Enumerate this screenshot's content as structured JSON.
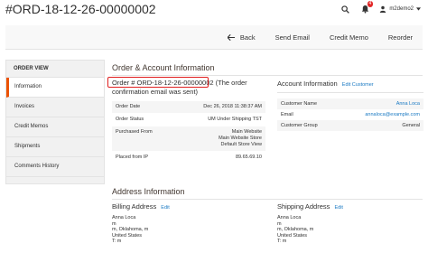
{
  "page": {
    "title": "#ORD-18-12-26-00000002"
  },
  "topbar": {
    "notification_count": "4",
    "username": "m2demo2"
  },
  "actions": {
    "back_label": "Back",
    "send_email_label": "Send Email",
    "credit_memo_label": "Credit Memo",
    "reorder_label": "Reorder"
  },
  "sidebar": {
    "heading": "ORDER VIEW",
    "items": [
      {
        "label": "Information"
      },
      {
        "label": "Invoices"
      },
      {
        "label": "Credit Memos"
      },
      {
        "label": "Shipments"
      },
      {
        "label": "Comments History"
      }
    ]
  },
  "order_account": {
    "section_title": "Order & Account Information",
    "order_line1": "Order # ORD-18-12-26-00000002 (The order",
    "order_line2": "confirmation email was sent)",
    "rows": [
      {
        "label": "Order Date",
        "value": "Dec 26, 2018 11:38:37 AM"
      },
      {
        "label": "Order Status",
        "value": "UM Under Shipping TST"
      },
      {
        "label": "Purchased From",
        "value1": "Main Website",
        "value2": "Main Website Store",
        "value3": "Default Store View"
      },
      {
        "label": "Placed from IP",
        "value": "89.65.69.10"
      }
    ]
  },
  "account_info": {
    "title": "Account Information",
    "edit_label": "Edit Customer",
    "rows": [
      {
        "label": "Customer Name",
        "value": "Anna Loca"
      },
      {
        "label": "Email",
        "value": "annaloca@example.com"
      },
      {
        "label": "Customer Group",
        "value": "General"
      }
    ]
  },
  "address": {
    "section_title": "Address Information",
    "billing": {
      "title": "Billing Address",
      "edit_label": "Edit",
      "lines": [
        "Anna Loca",
        "m",
        "m, Oklahoma, m",
        "United States",
        "T: m"
      ]
    },
    "shipping": {
      "title": "Shipping Address",
      "edit_label": "Edit",
      "lines": [
        "Anna Loca",
        "m",
        "m, Oklahoma, m",
        "United States",
        "T: m"
      ]
    }
  },
  "colors": {
    "accent": "#eb5202",
    "highlight_box": "#e02020",
    "link": "#1979c3",
    "badge": "#e22626"
  }
}
